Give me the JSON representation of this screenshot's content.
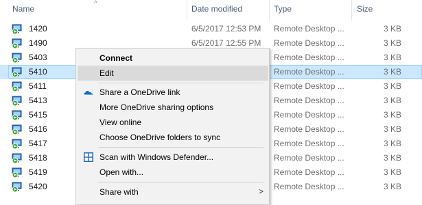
{
  "columns": {
    "name": "Name",
    "date": "Date modified",
    "type": "Type",
    "size": "Size"
  },
  "files": [
    {
      "name": "1420",
      "date": "6/5/2017 12:53 PM",
      "type": "Remote Desktop ...",
      "size": "3 KB"
    },
    {
      "name": "1490",
      "date": "6/5/2017 12:55 PM",
      "type": "Remote Desktop ...",
      "size": "3 KB"
    },
    {
      "name": "5403",
      "date": "",
      "type": "Remote Desktop ...",
      "size": "3 KB"
    },
    {
      "name": "5410",
      "date": "",
      "type": "Remote Desktop ...",
      "size": "3 KB",
      "selected": true
    },
    {
      "name": "5411",
      "date": "",
      "type": "Remote Desktop ...",
      "size": "3 KB"
    },
    {
      "name": "5413",
      "date": "",
      "type": "Remote Desktop ...",
      "size": "3 KB"
    },
    {
      "name": "5415",
      "date": "",
      "type": "Remote Desktop ...",
      "size": "3 KB"
    },
    {
      "name": "5416",
      "date": "",
      "type": "Remote Desktop ...",
      "size": "3 KB"
    },
    {
      "name": "5417",
      "date": "",
      "type": "Remote Desktop ...",
      "size": "3 KB"
    },
    {
      "name": "5418",
      "date": "",
      "type": "Remote Desktop ...",
      "size": "3 KB"
    },
    {
      "name": "5419",
      "date": "",
      "type": "Remote Desktop ...",
      "size": "3 KB"
    },
    {
      "name": "5420",
      "date": "",
      "type": "Remote Desktop ...",
      "size": "3 KB"
    }
  ],
  "context_menu": {
    "connect": "Connect",
    "edit": "Edit",
    "share_onedrive": "Share a OneDrive link",
    "more_onedrive": "More OneDrive sharing options",
    "view_online": "View online",
    "choose_folders": "Choose OneDrive folders to sync",
    "scan_defender": "Scan with Windows Defender...",
    "open_with": "Open with...",
    "share_with": "Share with"
  },
  "colors": {
    "selection_bg": "#cce8ff",
    "menu_bg": "#f2f2f2",
    "header_text": "#4c607a"
  }
}
